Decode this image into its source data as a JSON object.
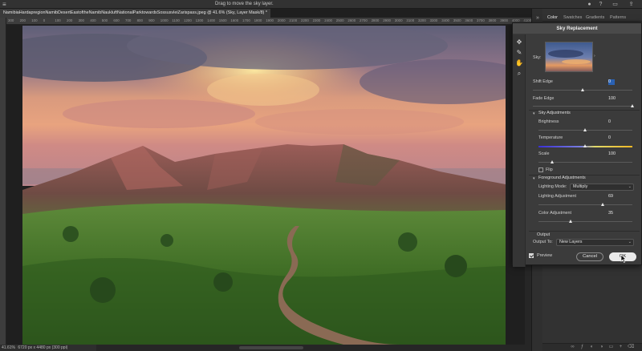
{
  "topbar": {
    "menu_icon": "hamburger-menu-icon",
    "hint": "Drag to move the sky layer.",
    "icons": [
      "user-avatar-icon",
      "help-icon",
      "workspace-icon",
      "share-icon"
    ]
  },
  "document": {
    "tab_title": "NamibiaHardapregionNamibDesertEastoftheNamibNaukluftNationalParktowardsSossusvleiZarispass.jpeg @ 41.6% (Sky, Layer Mask/8) *"
  },
  "ruler": {
    "ticks": [
      "300",
      "200",
      "100",
      "0",
      "100",
      "200",
      "300",
      "400",
      "500",
      "600",
      "700",
      "800",
      "900",
      "1000",
      "1100",
      "1200",
      "1300",
      "1400",
      "1500",
      "1600",
      "1700",
      "1800",
      "1900",
      "2000",
      "2100",
      "2200",
      "2300",
      "2400",
      "2500",
      "2600",
      "2700",
      "2800",
      "2900",
      "3000",
      "3100",
      "3200",
      "3300",
      "3400",
      "3500",
      "3600",
      "3700",
      "3800",
      "3900",
      "4000",
      "4100"
    ]
  },
  "status": {
    "zoom": "41.61%",
    "dimensions": "6720 px x 4480 px (300 ppi)"
  },
  "right_panel": {
    "tabs": [
      "Color",
      "Swatches",
      "Gradients",
      "Patterns"
    ],
    "active_tab": "Color"
  },
  "dialog": {
    "title": "Sky Replacement",
    "sky_label": "Sky:",
    "shift_edge": {
      "label": "Shift Edge",
      "value": "0",
      "level": 0.5
    },
    "fade_edge": {
      "label": "Fade Edge",
      "value": "100",
      "level": 1.0
    },
    "sky_adjustments": {
      "heading": "Sky Adjustments",
      "brightness": {
        "label": "Brightness",
        "value": "0",
        "level": 0.5
      },
      "temperature": {
        "label": "Temperature",
        "value": "0",
        "level": 0.5
      },
      "scale": {
        "label": "Scale",
        "value": "100",
        "level": 0.15
      },
      "flip": {
        "label": "Flip",
        "checked": false
      }
    },
    "foreground_adjustments": {
      "heading": "Foreground Adjustments",
      "lighting_mode": {
        "label": "Lighting Mode:",
        "value": "Multiply"
      },
      "lighting_adjustment": {
        "label": "Lighting Adjustment",
        "value": "69",
        "level": 0.69
      },
      "color_adjustment": {
        "label": "Color Adjustment",
        "value": "35",
        "level": 0.35
      }
    },
    "output": {
      "heading": "Output",
      "output_to_label": "Output To:",
      "output_to_value": "New Layers"
    },
    "preview": {
      "label": "Preview",
      "checked": true
    },
    "cancel_label": "Cancel",
    "ok_label": "OK",
    "tools": [
      "move-sky-icon",
      "sky-brush-icon",
      "hand-icon",
      "zoom-icon"
    ]
  }
}
